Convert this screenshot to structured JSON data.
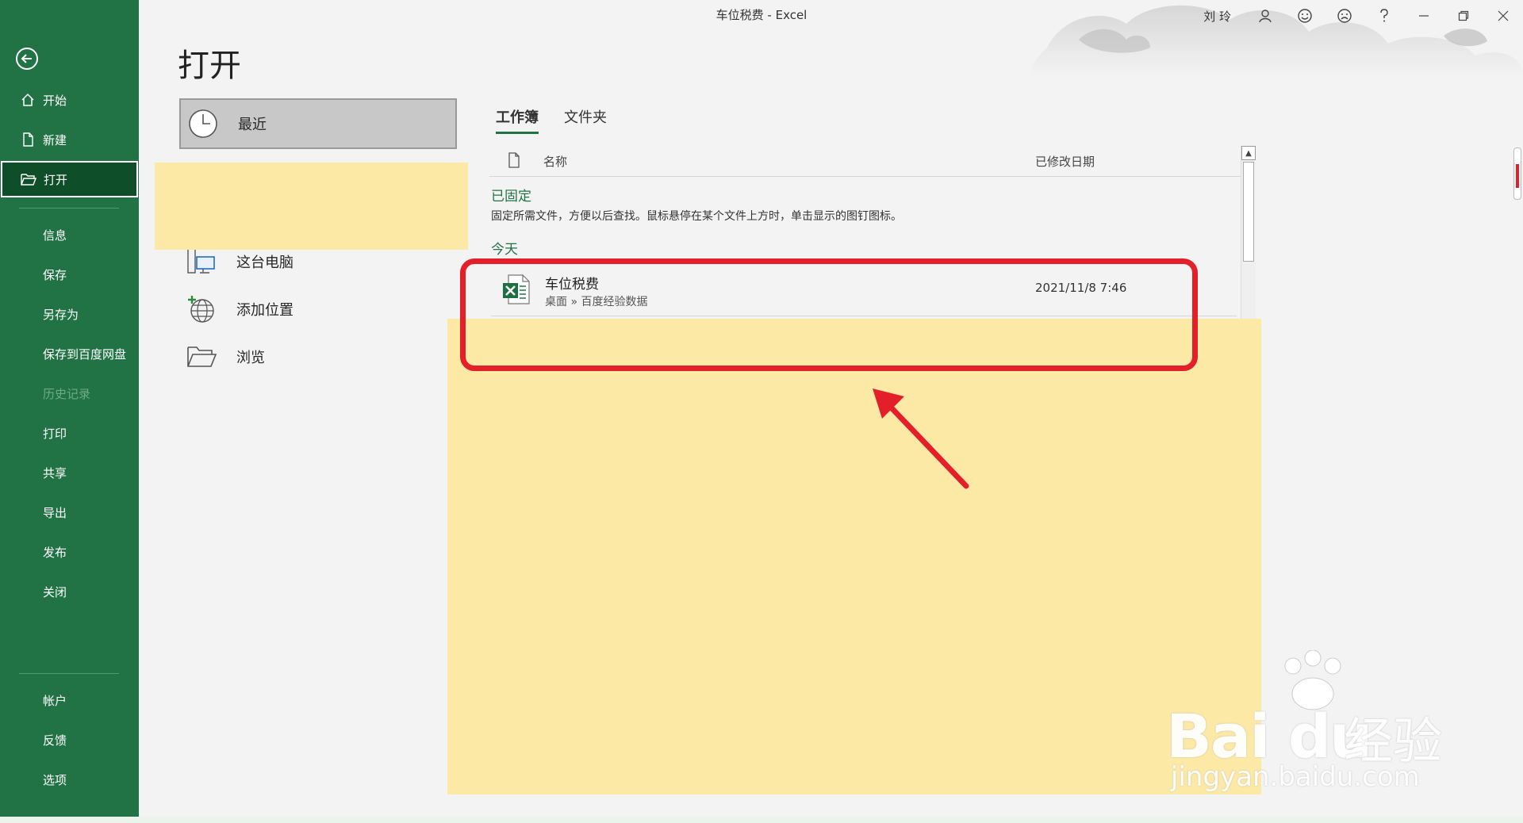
{
  "titlebar": {
    "title": "车位税费  -  Excel",
    "user": "刘 玲"
  },
  "sidebar": {
    "items": [
      {
        "label": "开始",
        "icon": "home-icon"
      },
      {
        "label": "新建",
        "icon": "new-file-icon"
      },
      {
        "label": "打开",
        "icon": "open-folder-icon"
      },
      {
        "label": "信息"
      },
      {
        "label": "保存"
      },
      {
        "label": "另存为"
      },
      {
        "label": "保存到百度网盘"
      },
      {
        "label": "历史记录"
      },
      {
        "label": "打印"
      },
      {
        "label": "共享"
      },
      {
        "label": "导出"
      },
      {
        "label": "发布"
      },
      {
        "label": "关闭"
      },
      {
        "label": "帐户"
      },
      {
        "label": "反馈"
      },
      {
        "label": "选项"
      }
    ]
  },
  "main": {
    "heading": "打开",
    "locations": [
      {
        "label": "最近",
        "icon": "clock-icon"
      },
      {
        "label": "这台电脑",
        "icon": "pc-icon"
      },
      {
        "label": "添加位置",
        "icon": "globe-plus-icon"
      },
      {
        "label": "浏览",
        "icon": "folder-icon"
      }
    ],
    "tabs": [
      "工作簿",
      "文件夹"
    ],
    "columns": {
      "name": "名称",
      "date": "已修改日期"
    },
    "pinned": {
      "title": "已固定",
      "description": "固定所需文件，方便以后查找。鼠标悬停在某个文件上方时，单击显示的图钉图标。"
    },
    "today": {
      "title": "今天",
      "files": [
        {
          "name": "车位税费",
          "path": "桌面 » 百度经验数据",
          "date": "2021/11/8 7:46"
        }
      ]
    }
  },
  "watermark": {
    "logo": "Bai du",
    "brand": "经验",
    "url": "jingyan.baidu.com"
  },
  "colors": {
    "excel_green": "#217346",
    "active_green": "#0e4f2a",
    "highlight_red": "#e3202a",
    "overlay_yellow": "#fde9a6"
  }
}
